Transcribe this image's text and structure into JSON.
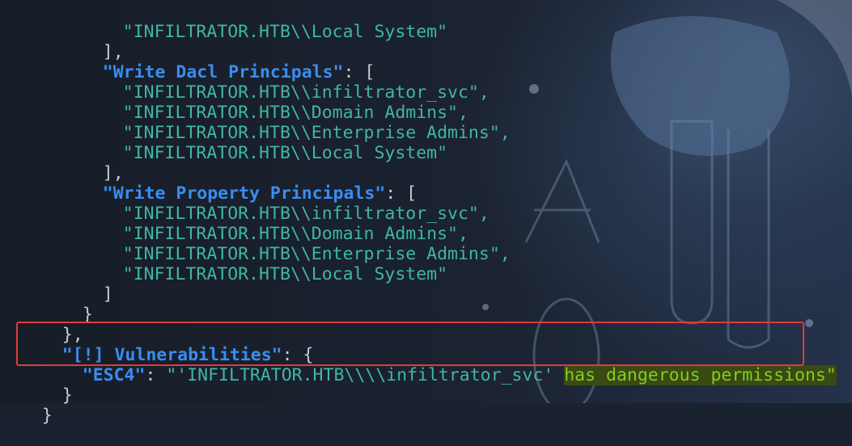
{
  "theme": {
    "key_color": "#3a8df0",
    "string_color": "#3fb6a6",
    "highlight_color": "#7fcf1f",
    "box_color": "#e03b3b"
  },
  "json_output": {
    "local_system_prev": "\"INFILTRATOR.HTB\\\\Local System\"",
    "close_bracket_1": "],",
    "write_dacl": {
      "key": "\"Write Dacl Principals\"",
      "sep": ": [",
      "items": [
        "\"INFILTRATOR.HTB\\\\infiltrator_svc\",",
        "\"INFILTRATOR.HTB\\\\Domain Admins\",",
        "\"INFILTRATOR.HTB\\\\Enterprise Admins\",",
        "\"INFILTRATOR.HTB\\\\Local System\""
      ],
      "close": "],"
    },
    "write_property": {
      "key": "\"Write Property Principals\"",
      "sep": ": [",
      "items": [
        "\"INFILTRATOR.HTB\\\\infiltrator_svc\",",
        "\"INFILTRATOR.HTB\\\\Domain Admins\",",
        "\"INFILTRATOR.HTB\\\\Enterprise Admins\",",
        "\"INFILTRATOR.HTB\\\\Local System\""
      ],
      "close": "]"
    },
    "close_brace_inner": "}",
    "close_brace_outer": "},",
    "vulnerabilities": {
      "key": "\"[!] Vulnerabilities\"",
      "sep": ": {",
      "esc4_key": "\"ESC4\"",
      "esc4_sep": ": ",
      "esc4_value_part1": "\"'INFILTRATOR.HTB\\\\\\\\infiltrator_svc'",
      "esc4_value_highlight": "has dangerous permissions\"",
      "close": "}"
    },
    "final_close": "}"
  }
}
